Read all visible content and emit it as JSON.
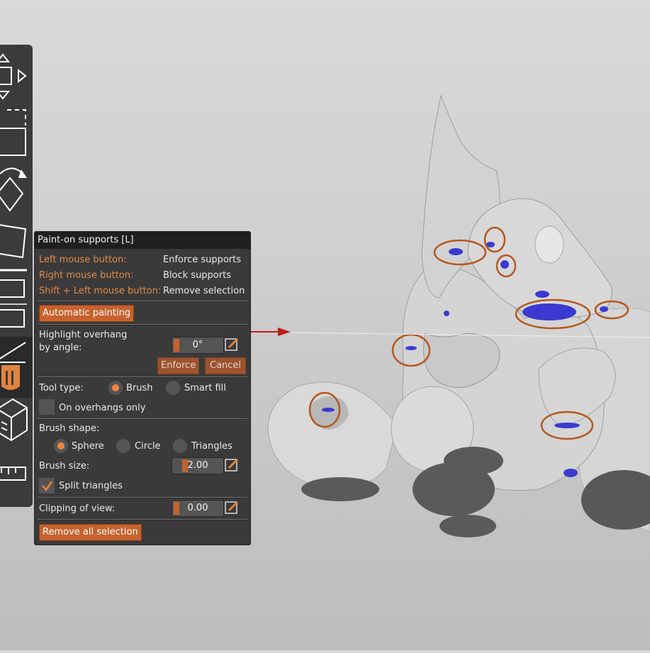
{
  "panel": {
    "title": "Paint-on supports [L]",
    "mouse_help": [
      {
        "key": "Left mouse button:",
        "action": "Enforce supports"
      },
      {
        "key": "Right mouse button:",
        "action": "Block supports"
      },
      {
        "key": "Shift + Left mouse button:",
        "action": "Remove selection"
      }
    ],
    "automatic_painting_label": "Automatic painting",
    "highlight_label_line1": "Highlight overhang",
    "highlight_label_line2": "by angle:",
    "highlight_value": "0°",
    "enforce_label": "Enforce",
    "cancel_label": "Cancel",
    "tool_type_label": "Tool type:",
    "tool_type_options": [
      "Brush",
      "Smart fill"
    ],
    "tool_type_selected": "Brush",
    "on_overhangs_only_label": "On overhangs only",
    "on_overhangs_only_checked": false,
    "brush_shape_label": "Brush shape:",
    "brush_shape_options": [
      "Sphere",
      "Circle",
      "Triangles"
    ],
    "brush_shape_selected": "Sphere",
    "brush_size_label": "Brush size:",
    "brush_size_value": "2.00",
    "split_triangles_label": "Split triangles",
    "split_triangles_checked": true,
    "clipping_label": "Clipping of view:",
    "clipping_value": "0.00",
    "remove_all_label": "Remove all selection"
  },
  "toolbar": {
    "tools": [
      "move-icon",
      "scale-icon",
      "rotate-icon",
      "place-on-face-icon",
      "cut-icon",
      "paint-supports-icon",
      "seam-painting-icon",
      "measure-icon"
    ],
    "active_tool": "paint-supports-icon"
  },
  "colors": {
    "accent": "#c7622e",
    "panel_bg": "#3a3a3a",
    "enforcer_blue": "#3a3ad0",
    "annotation_circle": "#b4571e",
    "model_gray": "#dcdcdc"
  }
}
